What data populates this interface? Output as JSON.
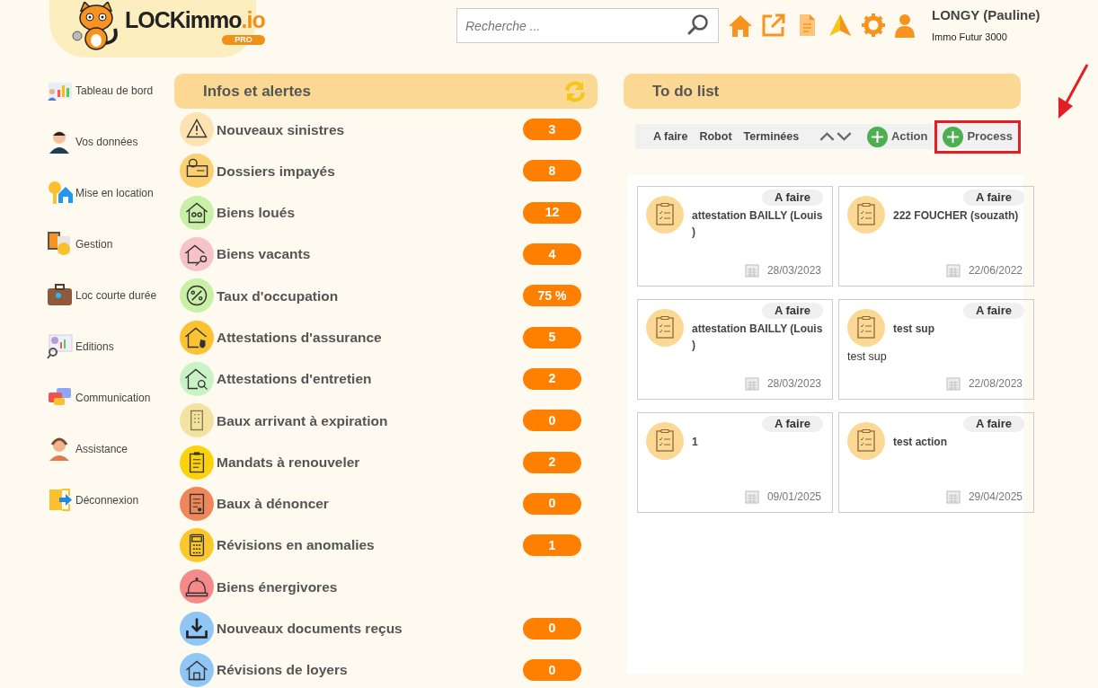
{
  "logo": {
    "name": "LOCKimmo",
    "suffix": ".io",
    "badge": "PRO"
  },
  "search": {
    "placeholder": "Recherche ..."
  },
  "user": {
    "name": "LONGY (Pauline)",
    "company": "Immo Futur 3000"
  },
  "sidebar": {
    "items": [
      {
        "label": "Tableau de bord"
      },
      {
        "label": "Vos données"
      },
      {
        "label": "Mise en location"
      },
      {
        "label": "Gestion"
      },
      {
        "label": "Loc courte durée"
      },
      {
        "label": "Editions"
      },
      {
        "label": "Communication"
      },
      {
        "label": "Assistance"
      },
      {
        "label": "Déconnexion"
      }
    ]
  },
  "alerts": {
    "title": "Infos et alertes",
    "items": [
      {
        "label": "Nouveaux sinistres",
        "count": "3",
        "color": "#fde2b2"
      },
      {
        "label": "Dossiers impayés",
        "count": "8",
        "color": "#fcd06e"
      },
      {
        "label": "Biens loués",
        "count": "12",
        "color": "#c8f0a6"
      },
      {
        "label": "Biens vacants",
        "count": "4",
        "color": "#f7c3c6"
      },
      {
        "label": "Taux d'occupation",
        "count": "75 %",
        "color": "#c8f0a6"
      },
      {
        "label": "Attestations d'assurance",
        "count": "5",
        "color": "#fbc232"
      },
      {
        "label": "Attestations d'entretien",
        "count": "2",
        "color": "#c9f3c6"
      },
      {
        "label": "Baux arrivant à expiration",
        "count": "0",
        "color": "#f3e3a1"
      },
      {
        "label": "Mandats à renouveler",
        "count": "2",
        "color": "#fdd20a"
      },
      {
        "label": "Baux à dénoncer",
        "count": "0",
        "color": "#f0875a"
      },
      {
        "label": "Révisions en anomalies",
        "count": "1",
        "color": "#fdc72a"
      },
      {
        "label": "Biens énergivores",
        "color": "#f58a8a"
      },
      {
        "label": "Nouveaux documents reçus",
        "count": "0",
        "color": "#8fc6f5"
      },
      {
        "label": "Révisions de loyers",
        "count": "0",
        "color": "#8fc6f5"
      }
    ]
  },
  "todo": {
    "title": "To do list",
    "filters": [
      "A faire",
      "Robot",
      "Terminées"
    ],
    "actions": [
      "Action",
      "Process"
    ],
    "cards": [
      {
        "status": "A faire",
        "title": "attestation BAILLY (Louis )",
        "date": "28/03/2023"
      },
      {
        "status": "A faire",
        "title": "222 FOUCHER (souzath)",
        "date": "22/06/2022"
      },
      {
        "status": "A faire",
        "title": "attestation BAILLY (Louis )",
        "date": "28/03/2023"
      },
      {
        "status": "A faire",
        "title": "test sup",
        "description": "test sup",
        "date": "22/08/2023"
      },
      {
        "status": "A faire",
        "title": "1",
        "date": "09/01/2025"
      },
      {
        "status": "A faire",
        "title": "test action",
        "date": "29/04/2025"
      }
    ]
  }
}
